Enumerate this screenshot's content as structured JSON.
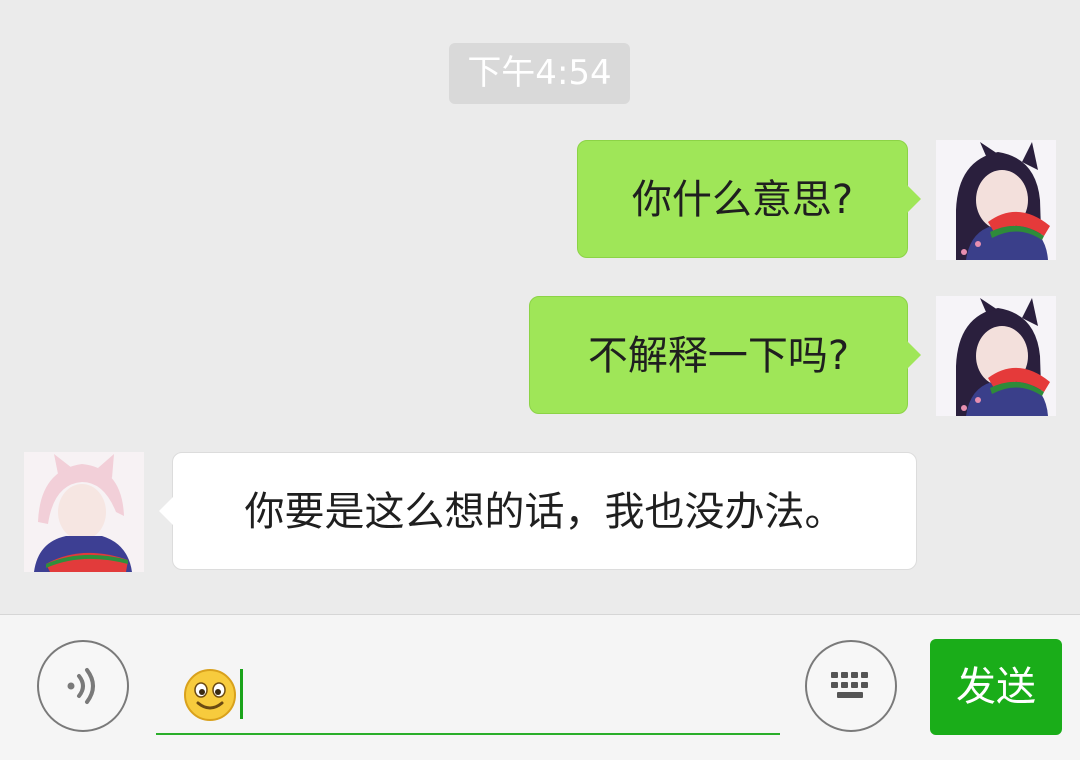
{
  "chat": {
    "timestamp": "下午4:54",
    "messages": [
      {
        "sender": "me",
        "text": "你什么意思?"
      },
      {
        "sender": "me",
        "text": "不解释一下吗?"
      },
      {
        "sender": "other",
        "text": "你要是这么想的话，我也没办法。"
      }
    ]
  },
  "input_bar": {
    "voice_icon": "voice-icon",
    "emoji": "smiley-emoji",
    "keyboard_icon": "keyboard-icon",
    "send_label": "发送",
    "accent_color": "#1aad19"
  }
}
